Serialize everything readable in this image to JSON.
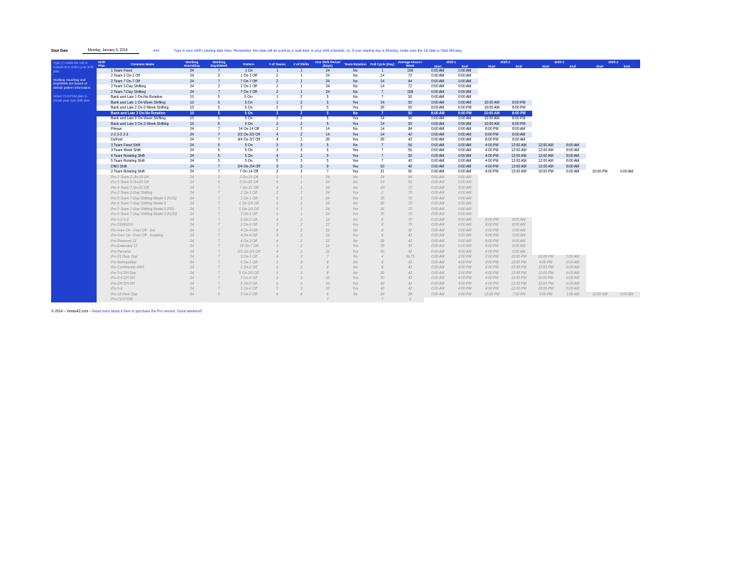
{
  "top": {
    "label": "Start Date",
    "value": "Monday, January 6, 2014",
    "arrow": "<<<",
    "hint": "Type in your shift's starting date here. Remember, this date will be used as a 'wall date' in your shift schedule, so, if your starting day is Monday, make sure the 1st date is Start Monday."
  },
  "side": {
    "s1": "Type 'y' inside the cell in column B to select your shift plan",
    "s2": "Working Hour/Day and Day/Week are based on default pattern information",
    "s3": "Select CUSTOM plan to create your own shift plan"
  },
  "cols": {
    "c0": "Shift Plan",
    "c1": "Common Name",
    "c2": "Working Hours/Day",
    "c3": "Working Days/Week",
    "c4": "Pattern",
    "c5": "# of Teams",
    "c6": "# of Shifts",
    "c7": "One Shift Period (Days)",
    "c8": "Team Rotation",
    "c9": "Full Cycle (Day)",
    "c10": "Average Hours / Week",
    "sh": [
      "Shift 1",
      "Shift 2",
      "Shift 3",
      "Shift 4"
    ],
    "sub": [
      "Start",
      "End"
    ]
  },
  "rows": [
    {
      "t": "band",
      "n": "1 Team Fixed",
      "h": "24",
      "d": "7",
      "p": "1 On",
      "tm": "1",
      "sf": "1",
      "pd": "24",
      "rot": "No",
      "cy": "1",
      "ah": "168",
      "s": [
        [
          "0:00 AM",
          "0:00 AM"
        ]
      ]
    },
    {
      "t": "plain",
      "n": "2 Team 1 On-1 Off",
      "h": "24",
      "d": "3",
      "p": "1 On-1 Off",
      "tm": "2",
      "sf": "1",
      "pd": "24",
      "rot": "No",
      "cy": "14",
      "ah": "72",
      "s": [
        [
          "0:00 AM",
          "0:00 AM"
        ]
      ]
    },
    {
      "t": "band",
      "n": "2 Team 7 On-7 Off",
      "h": "24",
      "d": "7",
      "p": "7 On-7 Off",
      "tm": "2",
      "sf": "1",
      "pd": "24",
      "rot": "No",
      "cy": "14",
      "ah": "84",
      "s": [
        [
          "0:00 AM",
          "0:00 AM"
        ]
      ]
    },
    {
      "t": "plain",
      "n": "2 Team 2-Day Shifting",
      "h": "24",
      "d": "2",
      "p": "1 On-1 Off",
      "tm": "2",
      "sf": "1",
      "pd": "24",
      "rot": "No",
      "cy": "14",
      "ah": "72",
      "s": [
        [
          "0:00 AM",
          "0:00 AM"
        ]
      ]
    },
    {
      "t": "band",
      "n": "2 Team 7-Day Shifting",
      "h": "24",
      "d": "7",
      "p": "7 On-7 Off",
      "tm": "2",
      "sf": "1",
      "pd": "24",
      "rot": "No",
      "cy": "7",
      "ah": "168",
      "s": [
        [
          "0:00 AM",
          "0:00 AM"
        ]
      ]
    },
    {
      "t": "plain",
      "n": "Bank and Late 1 On-No Rotation",
      "h": "10",
      "d": "5",
      "p": "5 On-",
      "tm": "1",
      "sf": "2",
      "pd": "5",
      "rot": "No",
      "cy": "7",
      "ah": "50",
      "s": [
        [
          "0:00 AM",
          "0:00 AM"
        ]
      ]
    },
    {
      "t": "band",
      "n": "Bank and Late 1 On-Week Shifting",
      "h": "10",
      "d": "5",
      "p": "5 On",
      "tm": "1",
      "sf": "2",
      "pd": "5",
      "rot": "Yes",
      "cy": "14",
      "ah": "50",
      "s": [
        [
          "0:00 AM",
          "0:00 AM"
        ],
        [
          "10:00 AM",
          "8:00 PM"
        ]
      ]
    },
    {
      "t": "plain",
      "n": "Bank and Late 2 On-2-Week Shifting",
      "h": "10",
      "d": "5",
      "p": "5 On",
      "tm": "2",
      "sf": "2",
      "pd": "5",
      "rot": "Yes",
      "cy": "28",
      "ah": "50",
      "s": [
        [
          "8:00 AM",
          "6:00 PM"
        ],
        [
          "10:00 AM",
          "8:00 PM"
        ]
      ]
    },
    {
      "t": "sel",
      "n": "Bank and Late 3 On-No Rotation",
      "h": "10",
      "d": "5",
      "p": "5 On",
      "tm": "3",
      "sf": "2",
      "pd": "5",
      "rot": "No",
      "cy": "7",
      "ah": "50",
      "s": [
        [
          "8:00 AM",
          "6:00 PM"
        ],
        [
          "10:00 AM",
          "8:00 PM"
        ]
      ]
    },
    {
      "t": "plain",
      "n": "Bank and Late 3 On-Week Shifting",
      "h": "10",
      "d": "5",
      "p": "5 On",
      "tm": "3",
      "sf": "2",
      "pd": "5",
      "rot": "Yes",
      "cy": "14",
      "ah": "50",
      "s": [
        [
          "0:00 AM",
          "0:00 AM"
        ],
        [
          "10:00 AM",
          "8:00 PM"
        ]
      ]
    },
    {
      "t": "band",
      "n": "Bank and Late 3 On-2-Week Shifting",
      "h": "10",
      "d": "5",
      "p": "5 On",
      "tm": "3",
      "sf": "2",
      "pd": "5",
      "rot": "Yes",
      "cy": "14",
      "ah": "50",
      "s": [
        [
          "0:00 AM",
          "0:00 AM"
        ],
        [
          "10:00 AM",
          "8:00 PM"
        ]
      ]
    },
    {
      "t": "plain",
      "n": "Pitman",
      "h": "24",
      "d": "7",
      "p": "14 On-14 Off",
      "tm": "2",
      "sf": "2",
      "pd": "14",
      "rot": "No",
      "cy": "14",
      "ah": "84",
      "s": [
        [
          "0:00 AM",
          "0:00 AM"
        ],
        [
          "8:00 PM",
          "8:00 AM"
        ]
      ]
    },
    {
      "t": "band",
      "n": "2-2 3-2 2-3",
      "h": "24",
      "d": "7",
      "p": "2/2 On-2/3 Off",
      "tm": "4",
      "sf": "2",
      "pd": "14",
      "rot": "Yes",
      "cy": "14",
      "ah": "42",
      "s": [
        [
          "0:00 AM",
          "0:00 AM"
        ],
        [
          "8:00 PM",
          "8:00 AM"
        ]
      ]
    },
    {
      "t": "plain",
      "n": "DuPont",
      "h": "24",
      "d": "7",
      "p": "4/4 On-3/7 Off",
      "tm": "4",
      "sf": "2",
      "pd": "28",
      "rot": "Yes",
      "cy": "28",
      "ah": "42",
      "s": [
        [
          "0:00 AM",
          "0:00 AM"
        ],
        [
          "8:00 PM",
          "8:00 AM"
        ]
      ]
    },
    {
      "t": "band",
      "n": "3 Team Fixed Shift",
      "h": "24",
      "d": "5",
      "p": "5 On",
      "tm": "3",
      "sf": "3",
      "pd": "5",
      "rot": "No",
      "cy": "7",
      "ah": "56",
      "s": [
        [
          "0:00 AM",
          "0:00 AM"
        ],
        [
          "4:00 PM",
          "12:00 AM"
        ],
        [
          "12:00 AM",
          "8:00 AM"
        ]
      ]
    },
    {
      "t": "plain",
      "n": "3 Team Week Shift",
      "h": "24",
      "d": "5",
      "p": "5 On",
      "tm": "3",
      "sf": "3",
      "pd": "5",
      "rot": "Yes",
      "cy": "7",
      "ah": "56",
      "s": [
        [
          "0:00 AM",
          "0:00 AM"
        ],
        [
          "4:00 PM",
          "12:00 AM"
        ],
        [
          "12:00 AM",
          "8:00 AM"
        ]
      ]
    },
    {
      "t": "band",
      "n": "4 Team Rotating Shift",
      "h": "24",
      "d": "5",
      "p": "5 On",
      "tm": "4",
      "sf": "3",
      "pd": "5",
      "rot": "Yes",
      "cy": "7",
      "ah": "50",
      "s": [
        [
          "0:00 AM",
          "0:00 AM"
        ],
        [
          "4:00 PM",
          "12:00 AM"
        ],
        [
          "12:00 AM",
          "8:00 AM"
        ]
      ]
    },
    {
      "t": "plain",
      "n": "5 Team Rotating Shift",
      "h": "24",
      "d": "5",
      "p": "5 On",
      "tm": "5",
      "sf": "3",
      "pd": "5",
      "rot": "Yes",
      "cy": "7",
      "ah": "42",
      "s": [
        [
          "0:00 AM",
          "0:00 AM"
        ],
        [
          "4:00 PM",
          "12:00 AM"
        ],
        [
          "12:00 AM",
          "8:00 AM"
        ]
      ]
    },
    {
      "t": "band",
      "n": "DNO Shift",
      "h": "24",
      "d": "7",
      "p": "2/4 On-2/4 Off",
      "tm": "3",
      "sf": "3",
      "pd": "9",
      "rot": "Yes",
      "cy": "63",
      "ah": "40",
      "s": [
        [
          "0:00 AM",
          "0:00 AM"
        ],
        [
          "4:00 PM",
          "12:00 AM"
        ],
        [
          "12:00 AM",
          "8:00 AM"
        ]
      ]
    },
    {
      "t": "plain",
      "n": "2 Team Rotating Shift",
      "h": "24",
      "d": "7",
      "p": "7 On-14 Off",
      "tm": "3",
      "sf": "3",
      "pd": "7",
      "rot": "Yes",
      "cy": "21",
      "ah": "56",
      "s": [
        [
          "0:00 AM",
          "0:00 AM"
        ],
        [
          "4:00 PM",
          "12:00 AM"
        ],
        [
          "10:00 PM",
          "6:00 AM"
        ],
        [
          "10:00 PM",
          "6:00 AM"
        ]
      ]
    },
    {
      "t": "pro",
      "n": "Pro   2 Team 2 On-10 Off",
      "h": "24",
      "d": "2",
      "p": "2 On-10 Off",
      "tm": "2",
      "sf": "1",
      "pd": "24",
      "rot": "No",
      "cy": "24",
      "ah": "84",
      "s": [
        [
          "0:00 AM",
          "0:00 AM"
        ]
      ]
    },
    {
      "t": "pro",
      "n": "Pro   5 Team 5 On-25 Off",
      "h": "24",
      "d": "5",
      "p": "5 On-25 Off",
      "tm": "5",
      "sf": "1",
      "pd": "24",
      "rot": "No",
      "cy": "24",
      "ah": "56",
      "s": [
        [
          "0:00 AM",
          "0:00 AM"
        ]
      ]
    },
    {
      "t": "pro",
      "n": "Pro   4 Team 7 On-21 Off",
      "h": "24",
      "d": "7",
      "p": "7 On-21 Off",
      "tm": "4",
      "sf": "1",
      "pd": "24",
      "rot": "No",
      "cy": "24",
      "ah": "70",
      "s": [
        [
          "0:00 AM",
          "0:00 AM"
        ]
      ]
    },
    {
      "t": "pro",
      "n": "Pro   2 Team 2-Day Shifting",
      "h": "24",
      "d": "7",
      "p": "1 On-1 Off",
      "tm": "2",
      "sf": "1",
      "pd": "24",
      "rot": "Yes",
      "cy": "2",
      "ah": "70",
      "s": [
        [
          "0:00 AM",
          "0:00 AM"
        ]
      ]
    },
    {
      "t": "pro",
      "n": "Pro   5 Team 7-Day Shifting Model 1 (FOS)",
      "h": "24",
      "d": "7",
      "p": "1 On-1 Off",
      "tm": "5",
      "sf": "1",
      "pd": "24",
      "rot": "Yes",
      "cy": "35",
      "ah": "70",
      "s": [
        [
          "0:00 AM",
          "0:00 AM"
        ]
      ]
    },
    {
      "t": "pro",
      "n": "Pro   4 Team 7-Day Shifting Model 2",
      "h": "24",
      "d": "7",
      "p": "1 On-1/6 Off",
      "tm": "4",
      "sf": "1",
      "pd": "24",
      "rot": "No",
      "cy": "56",
      "ah": "70",
      "s": [
        [
          "0:00 AM",
          "0:00 AM"
        ]
      ]
    },
    {
      "t": "pro",
      "n": "Pro   5 Team 7-Day Shifting Model 2 (FR)",
      "h": "24",
      "d": "7",
      "p": "1 On-1/6 Off",
      "tm": "5",
      "sf": "1",
      "pd": "24",
      "rot": "Yes",
      "cy": "35",
      "ah": "70",
      "s": [
        [
          "0:00 AM",
          "0:00 AM"
        ]
      ]
    },
    {
      "t": "pro",
      "n": "Pro   5 Team 7-Day Shifting Model 3 (KON)",
      "h": "24",
      "d": "7",
      "p": "1 On-1 Off",
      "tm": "5",
      "sf": "1",
      "pd": "24",
      "rot": "Yes",
      "cy": "35",
      "ah": "70",
      "s": [
        [
          "0:00 AM",
          "0:00 AM"
        ]
      ]
    },
    {
      "t": "pro",
      "n": "Pro   6-2 6-2",
      "h": "24",
      "d": "7",
      "p": "6 On-2 Off",
      "tm": "4",
      "sf": "2",
      "pd": "12",
      "rot": "No",
      "cy": "8",
      "ah": "70",
      "s": [
        [
          "0:00 AM",
          "0:00 AM"
        ],
        [
          "8:00 PM",
          "8:00 AM"
        ]
      ]
    },
    {
      "t": "pro",
      "n": "Pro   DDNNOO",
      "h": "24",
      "d": "7",
      "p": "2 On-2 Off",
      "tm": "3",
      "sf": "2",
      "pd": "12",
      "rot": "Yes",
      "cy": "8",
      "ah": "70",
      "s": [
        [
          "0:00 AM",
          "0:00 AM"
        ],
        [
          "8:00 PM",
          "8:00 AM"
        ]
      ]
    },
    {
      "t": "pro",
      "n": "Pro   Four On - Four Off - 3rd",
      "h": "24",
      "d": "7",
      "p": "4 On-4 Off",
      "tm": "4",
      "sf": "2",
      "pd": "12",
      "rot": "No",
      "cy": "8",
      "ah": "42",
      "s": [
        [
          "0:00 AM",
          "0:00 AM"
        ],
        [
          "4:00 PM",
          "0:00 AM"
        ]
      ]
    },
    {
      "t": "pro",
      "n": "Pro   Four On - Four Off - Rotating",
      "h": "24",
      "d": "7",
      "p": "4 On-4 Off",
      "tm": "4",
      "sf": "2",
      "pd": "12",
      "rot": "Yes",
      "cy": "8",
      "ah": "42",
      "s": [
        [
          "0:00 AM",
          "0:00 AM"
        ],
        [
          "4:00 PM",
          "0:00 AM"
        ]
      ]
    },
    {
      "t": "pro",
      "n": "Pro   Powered 12",
      "h": "24",
      "d": "7",
      "p": "4 On-3 Off",
      "tm": "4",
      "sf": "2",
      "pd": "12",
      "rot": "No",
      "cy": "28",
      "ah": "42",
      "s": [
        [
          "0:00 AM",
          "0:00 AM"
        ],
        [
          "8:00 PM",
          "8:00 AM"
        ]
      ]
    },
    {
      "t": "pro",
      "n": "Pro   Extended 12",
      "h": "24",
      "d": "7",
      "p": "14 On-7 Off",
      "tm": "3",
      "sf": "2",
      "pd": "12",
      "rot": "Yes",
      "cy": "28",
      "ah": "50",
      "s": [
        [
          "0:00 AM",
          "0:00 AM"
        ],
        [
          "8:00 PM",
          "8:00 AM"
        ]
      ]
    },
    {
      "t": "pro",
      "n": "Pro   Panama",
      "h": "24",
      "d": "7",
      "p": "2/3 On-2/3 Off",
      "tm": "4",
      "sf": "2",
      "pd": "12",
      "rot": "Yes",
      "cy": "56",
      "ah": "42",
      "s": [
        [
          "0:00 AM",
          "0:00 AM"
        ],
        [
          "4:00 PM",
          "0:00 AM"
        ]
      ]
    },
    {
      "t": "pro",
      "n": "Pro   21 Hour Day",
      "h": "24",
      "d": "7",
      "p": "3 On-1 Off",
      "tm": "4",
      "sf": "3",
      "pd": "7",
      "rot": "No",
      "cy": "4",
      "ah": "36.75",
      "s": [
        [
          "0:00 AM",
          "2:00 PM"
        ],
        [
          "2:00 PM",
          "10:00 PM"
        ],
        [
          "10:00 PM",
          "5:00 AM"
        ]
      ]
    },
    {
      "t": "pro",
      "n": "Pro   Metropolitan",
      "h": "24",
      "d": "7",
      "p": "6 On-1 Off",
      "tm": "3",
      "sf": "3",
      "pd": "8",
      "rot": "No",
      "cy": "8",
      "ah": "42",
      "s": [
        [
          "0:00 AM",
          "4:00 PM"
        ],
        [
          "4:00 PM",
          "12:00 PM"
        ],
        [
          "4:00 PM",
          "0:00 AM"
        ]
      ]
    },
    {
      "t": "pro",
      "n": "Pro   Continental 4/8/6",
      "h": "24",
      "d": "7",
      "p": "2 On-2 Off",
      "tm": "4",
      "sf": "3",
      "pd": "8",
      "rot": "No",
      "cy": "8",
      "ah": "42",
      "s": [
        [
          "0:00 AM",
          "4:00 PM"
        ],
        [
          "4:00 PM",
          "12:00 PM"
        ],
        [
          "10:00 PM",
          "6:00 AM"
        ]
      ]
    },
    {
      "t": "pro",
      "n": "Pro   5-6 DH Day",
      "h": "24",
      "d": "7",
      "p": "5 On-2/6 Off",
      "tm": "5",
      "sf": "3",
      "pd": "8",
      "rot": "No",
      "cy": "35",
      "ah": "42",
      "s": [
        [
          "0:00 AM",
          "2:00 PM"
        ],
        [
          "4:00 PM",
          "12:00 PM"
        ],
        [
          "10:00 PM",
          "6:00 AM"
        ]
      ]
    },
    {
      "t": "pro",
      "n": "Pro   2-4 DH DH",
      "h": "24",
      "d": "7",
      "p": "2 On-4 Off",
      "tm": "3",
      "sf": "3",
      "pd": "10",
      "rot": "Yes",
      "cy": "50",
      "ah": "42",
      "s": [
        [
          "0:00 AM",
          "4:00 PM"
        ],
        [
          "4:00 PM",
          "12:00 PM"
        ],
        [
          "10:00 PM",
          "6:00 AM"
        ]
      ]
    },
    {
      "t": "pro",
      "n": "Pro   DH DH DH",
      "h": "24",
      "d": "7",
      "p": "5 On-2 Off",
      "tm": "5",
      "sf": "3",
      "pd": "10",
      "rot": "Yes",
      "cy": "42",
      "ah": "42",
      "s": [
        [
          "0:00 AM",
          "4:00 PM"
        ],
        [
          "4:00 PM",
          "12:00 PM"
        ],
        [
          "10:00 PM",
          "6:00 AM"
        ]
      ]
    },
    {
      "t": "pro",
      "n": "Pro   5-6",
      "h": "24",
      "d": "7",
      "p": "5 On-2 Off",
      "tm": "5",
      "sf": "3",
      "pd": "10",
      "rot": "Yes",
      "cy": "42",
      "ah": "42",
      "s": [
        [
          "0:00 AM",
          "4:00 PM"
        ],
        [
          "4:00 PM",
          "12:00 PM"
        ],
        [
          "10:00 PM",
          "6:00 AM"
        ]
      ]
    },
    {
      "t": "pro",
      "n": "Pro   18 Hour Day",
      "h": "24",
      "d": "5",
      "p": "5 On-2 Off",
      "tm": "4",
      "sf": "4",
      "pd": "6",
      "rot": "No",
      "cy": "24",
      "ah": "28",
      "s": [
        [
          "0:00 AM",
          "2:00 PM"
        ],
        [
          "12:00 PM",
          "7:00 PM"
        ],
        [
          "6:00 PM",
          "1:00 AM"
        ],
        [
          "12:00 AM",
          "6:00 AM"
        ]
      ]
    },
    {
      "t": "pro",
      "n": "Pro   CUSTOM",
      "h": "",
      "d": "",
      "p": "",
      "tm": "",
      "sf": "",
      "pd": "7",
      "rot": "",
      "cy": "7",
      "ah": "0",
      "s": []
    }
  ],
  "footer": {
    "copy": "© 2014 – Vertex42.com – ",
    "link": "Read more about it here to purchase the Pro version. Good weekend!"
  }
}
